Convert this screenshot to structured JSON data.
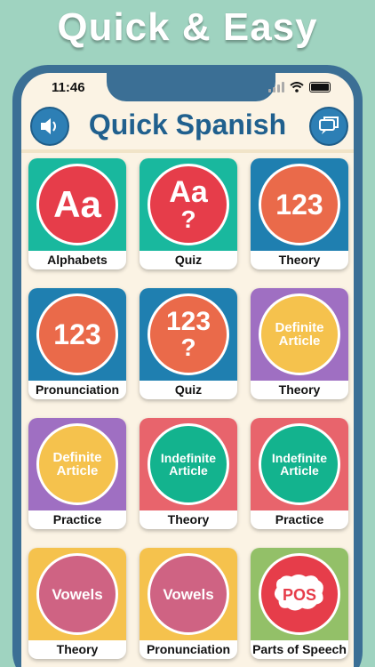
{
  "promo": {
    "headline": "Quick & Easy"
  },
  "status_bar": {
    "time": "11:46"
  },
  "header": {
    "title": "Quick Spanish",
    "left_icon": "speaker-icon",
    "right_icon": "chat-bubble-icon"
  },
  "colors": {
    "background": "#9fd3c0",
    "phone_frame": "#3b6f95",
    "title": "#20608e",
    "teal": "#19b89e",
    "red": "#e63d4a",
    "blue": "#1f7fb0",
    "orange": "#ea6a4a",
    "purple": "#9f6fc2",
    "yellow": "#f5c24d",
    "pink": "#e8646c",
    "green": "#13b38e",
    "rose": "#cf6383",
    "green_light": "#93c068"
  },
  "tiles": [
    {
      "label": "Alphabets",
      "icon_text": "Aa",
      "icon_sub": "",
      "bg": "#19b89e",
      "circle": "#e63d4a",
      "font": 42
    },
    {
      "label": "Quiz",
      "icon_text": "Aa",
      "icon_sub": "?",
      "bg": "#19b89e",
      "circle": "#e63d4a",
      "font": 34
    },
    {
      "label": "Theory",
      "icon_text": "123",
      "icon_sub": "",
      "bg": "#1f7fb0",
      "circle": "#ea6a4a",
      "font": 32
    },
    {
      "label": "Pronunciation",
      "icon_text": "123",
      "icon_sub": "",
      "bg": "#1f7fb0",
      "circle": "#ea6a4a",
      "font": 32
    },
    {
      "label": "Quiz",
      "icon_text": "123",
      "icon_sub": "?",
      "bg": "#1f7fb0",
      "circle": "#ea6a4a",
      "font": 30
    },
    {
      "label": "Theory",
      "icon_text": "Definite Article",
      "icon_sub": "",
      "bg": "#9f6fc2",
      "circle": "#f5c24d",
      "font": 15
    },
    {
      "label": "Practice",
      "icon_text": "Definite Article",
      "icon_sub": "",
      "bg": "#9f6fc2",
      "circle": "#f5c24d",
      "font": 15
    },
    {
      "label": "Theory",
      "icon_text": "Indefinite Article",
      "icon_sub": "",
      "bg": "#e8646c",
      "circle": "#13b38e",
      "font": 14
    },
    {
      "label": "Practice",
      "icon_text": "Indefinite Article",
      "icon_sub": "",
      "bg": "#e8646c",
      "circle": "#13b38e",
      "font": 14
    },
    {
      "label": "Theory",
      "icon_text": "Vowels",
      "icon_sub": "",
      "bg": "#f5c24d",
      "circle": "#cf6383",
      "font": 17
    },
    {
      "label": "Pronunciation",
      "icon_text": "Vowels",
      "icon_sub": "",
      "bg": "#f5c24d",
      "circle": "#cf6383",
      "font": 17
    },
    {
      "label": "Parts of Speech",
      "icon_text": "POS",
      "icon_sub": "",
      "bg": "#93c068",
      "circle": "#e63d4a",
      "font": 18
    }
  ]
}
